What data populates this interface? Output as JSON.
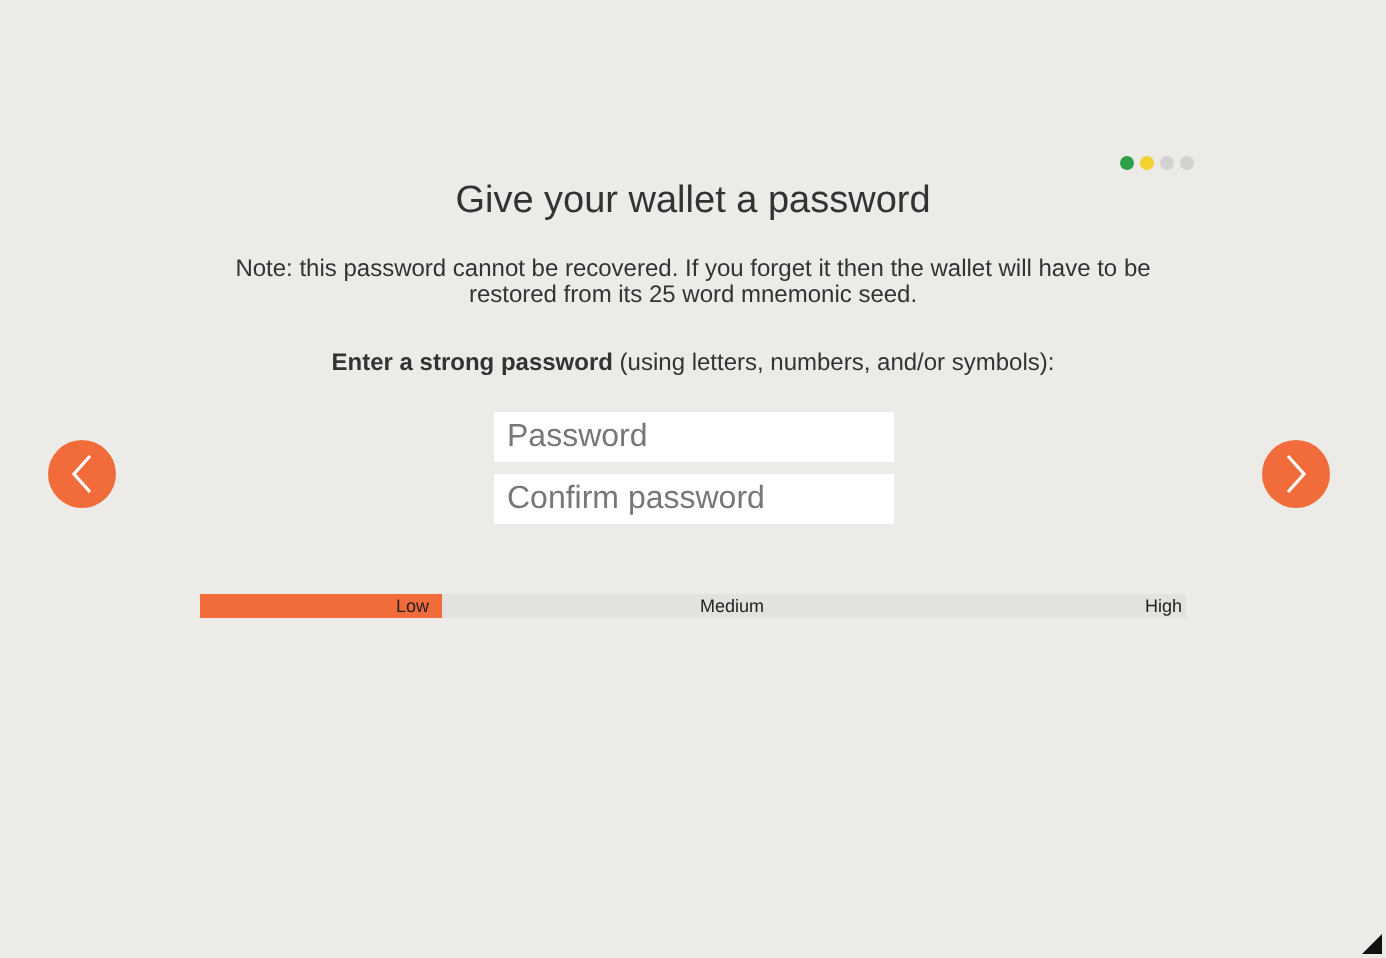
{
  "steps": [
    {
      "color": "#2e9e48"
    },
    {
      "color": "#f2d22e"
    },
    {
      "color": "#d4d2ce"
    },
    {
      "color": "#d4d2ce"
    }
  ],
  "title": "Give your wallet a password",
  "note": "Note: this password cannot be recovered. If you forget it then the wallet will have to be restored from its 25 word mnemonic seed.",
  "prompt": "**Enter a strong password** (using letters, numbers, and/or symbols):",
  "fields": [
    {
      "placeholder": "Password"
    },
    {
      "placeholder": "Confirm password"
    }
  ],
  "strength": {
    "level": 0.245,
    "labels": [
      "Low",
      "Medium",
      "High"
    ]
  }
}
